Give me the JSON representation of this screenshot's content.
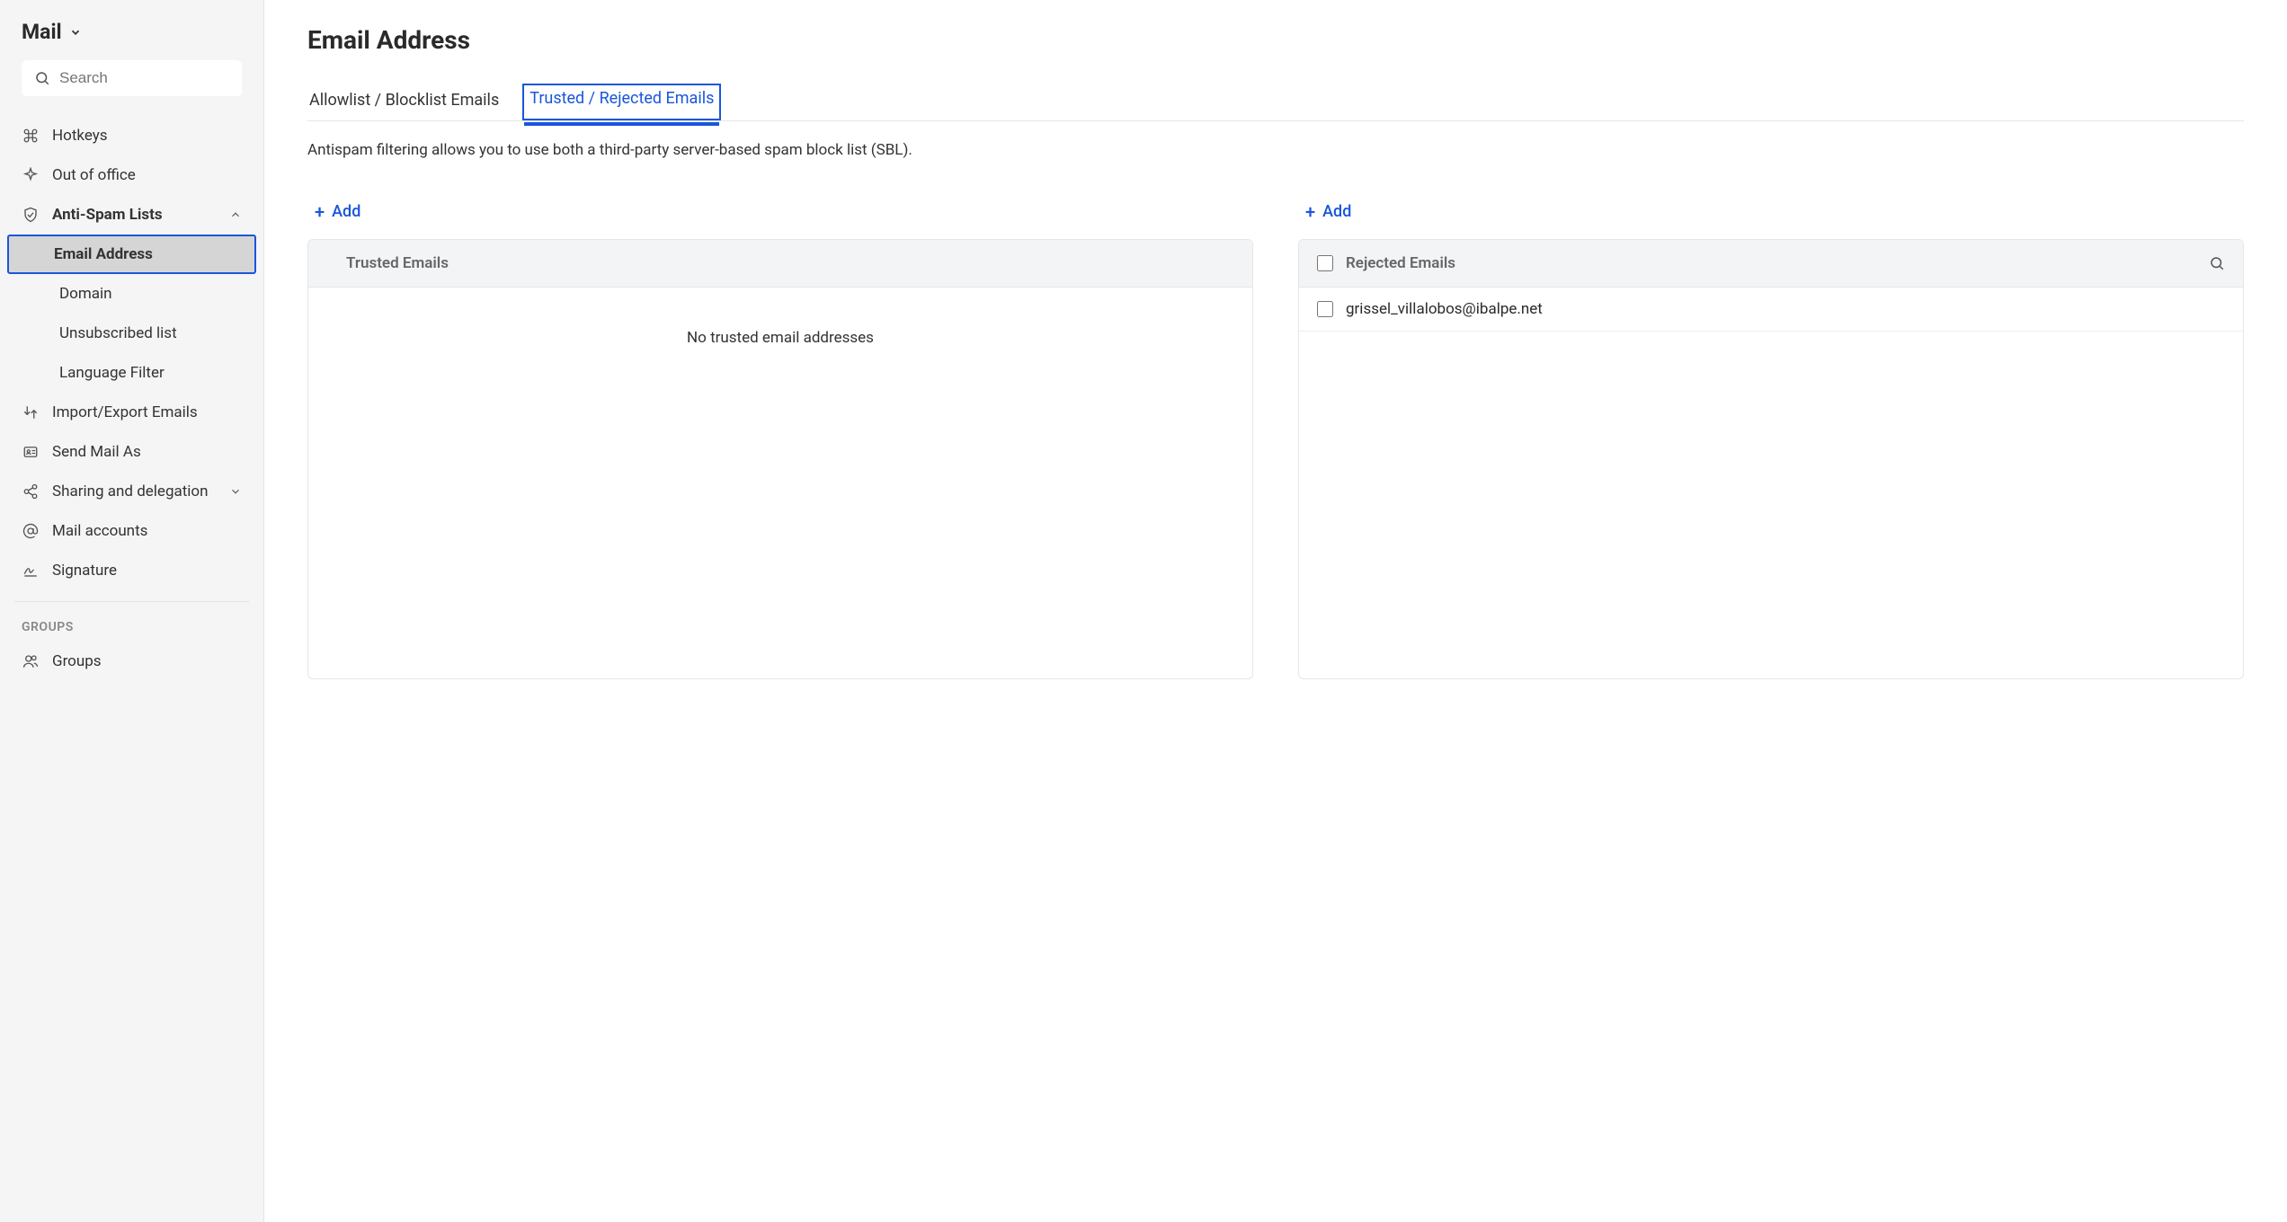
{
  "sidebar": {
    "title": "Mail",
    "search_placeholder": "Search",
    "items": {
      "hotkeys": "Hotkeys",
      "out_of_office": "Out of office",
      "anti_spam": "Anti-Spam Lists",
      "email_address": "Email Address",
      "domain": "Domain",
      "unsubscribed": "Unsubscribed list",
      "language_filter": "Language Filter",
      "import_export": "Import/Export Emails",
      "send_mail_as": "Send Mail As",
      "sharing": "Sharing and delegation",
      "mail_accounts": "Mail accounts",
      "signature": "Signature"
    },
    "groups_label": "GROUPS",
    "groups_item": "Groups"
  },
  "page": {
    "title": "Email Address",
    "tabs": {
      "allow_block": "Allowlist / Blocklist Emails",
      "trusted_rejected": "Trusted / Rejected Emails"
    },
    "description": "Antispam filtering allows you to use both a third-party server-based spam block list (SBL).",
    "add_label": "Add",
    "trusted": {
      "header": "Trusted Emails",
      "empty": "No trusted email addresses"
    },
    "rejected": {
      "header": "Rejected Emails",
      "rows": [
        "grissel_villalobos@ibalpe.net"
      ]
    }
  }
}
